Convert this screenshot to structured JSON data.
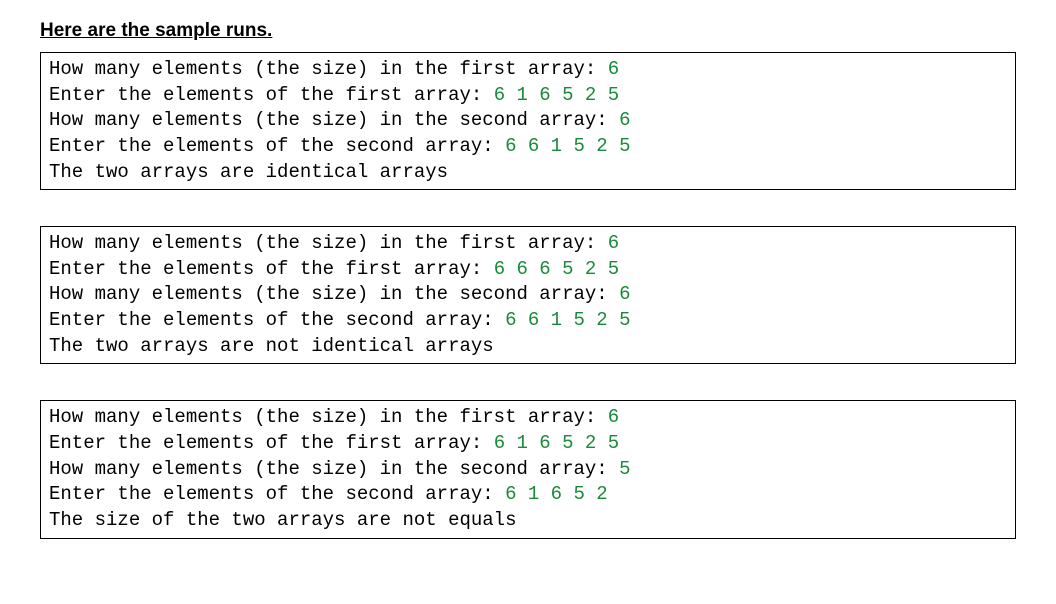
{
  "heading": "Here are the sample runs.",
  "runs": [
    {
      "lines": [
        {
          "prompt": "How many elements (the size) in the first array: ",
          "input": "6"
        },
        {
          "prompt": "Enter the elements of the first array: ",
          "input": "6 1 6 5 2 5"
        },
        {
          "prompt": "How many elements (the size) in the second array: ",
          "input": "6"
        },
        {
          "prompt": "Enter the elements of the second array: ",
          "input": "6 6 1 5 2 5"
        },
        {
          "prompt": "The two arrays are identical arrays",
          "input": ""
        }
      ]
    },
    {
      "lines": [
        {
          "prompt": "How many elements (the size) in the first array: ",
          "input": "6"
        },
        {
          "prompt": "Enter the elements of the first array: ",
          "input": "6 6 6 5 2 5"
        },
        {
          "prompt": "How many elements (the size) in the second array: ",
          "input": "6"
        },
        {
          "prompt": "Enter the elements of the second array: ",
          "input": "6 6 1 5 2 5"
        },
        {
          "prompt": "The two arrays are not identical arrays",
          "input": ""
        }
      ]
    },
    {
      "lines": [
        {
          "prompt": "How many elements (the size) in the first array: ",
          "input": "6"
        },
        {
          "prompt": "Enter the elements of the first array: ",
          "input": "6 1 6 5 2 5"
        },
        {
          "prompt": "How many elements (the size) in the second array: ",
          "input": "5"
        },
        {
          "prompt": "Enter the elements of the second array: ",
          "input": "6 1 6 5 2"
        },
        {
          "prompt": "The size of the two arrays are not equals",
          "input": ""
        }
      ]
    }
  ]
}
